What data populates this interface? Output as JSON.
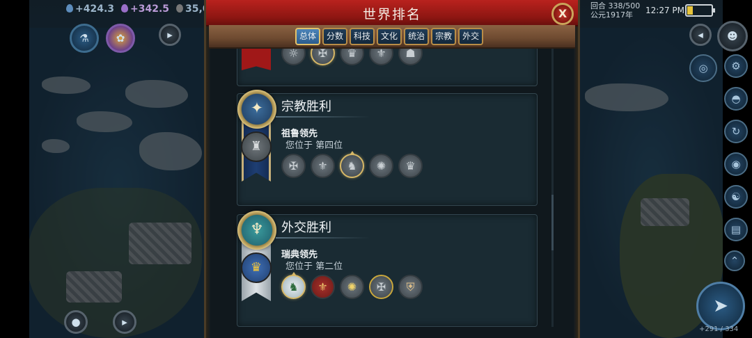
{
  "status_bar": {
    "science": "+424.3",
    "faith": "+342.5",
    "gold": "35,0",
    "turn": "回合 338/500",
    "date": "公元1917年",
    "clock": "12:27 PM"
  },
  "panel": {
    "title": "世界排名",
    "close_label": "X",
    "tabs": [
      "总体",
      "分数",
      "科技",
      "文化",
      "统治",
      "宗教",
      "外交"
    ],
    "active_tab": "总体"
  },
  "cards": {
    "religion": {
      "title": "宗教胜利",
      "leader_text": "祖鲁领先",
      "rank_text": "您位于 第四位",
      "civs": [
        "iron-cross-icon",
        "fleur-de-lis-icon",
        "wolf-head-icon",
        "sun-icon",
        "crown-icon"
      ],
      "highlighted_civ": 2
    },
    "diplomacy": {
      "title": "外交胜利",
      "leader_text": "瑞典领先",
      "rank_text": "您位于 第二位",
      "civs": [
        "wolf-head-icon",
        "fleur-de-lis-icon",
        "sun-icon",
        "iron-cross-icon",
        "shield-icon"
      ],
      "highlighted_civ": 0
    }
  },
  "map_hud": {
    "bottom_right": "+291 / 334"
  },
  "colors": {
    "banner_red": "#8d1612",
    "tab_active": "#2b5c8c",
    "gold_trim": "#d7b867"
  }
}
